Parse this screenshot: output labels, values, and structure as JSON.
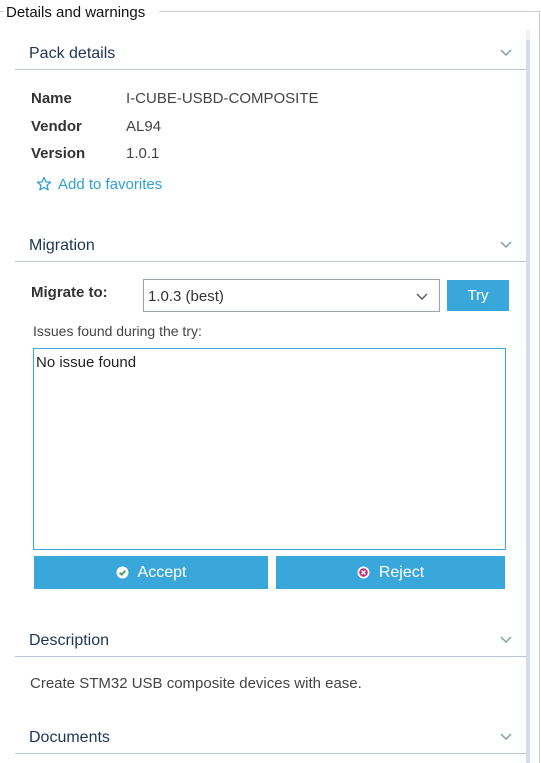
{
  "group": {
    "title": "Details and warnings"
  },
  "pack_details": {
    "header": "Pack details",
    "rows": [
      {
        "key": "Name",
        "value": "I-CUBE-USBD-COMPOSITE"
      },
      {
        "key": "Vendor",
        "value": "AL94"
      },
      {
        "key": "Version",
        "value": "1.0.1"
      }
    ],
    "favorites_label": "Add to favorites"
  },
  "migration": {
    "header": "Migration",
    "migrate_to_label": "Migrate to:",
    "selected_option": "1.0.3 (best)",
    "try_label": "Try",
    "issues_label": "Issues found during the try:",
    "issues_text": "No issue found",
    "accept_label": "Accept",
    "reject_label": "Reject"
  },
  "description": {
    "header": "Description",
    "text": "Create STM32 USB composite devices with ease."
  },
  "documents": {
    "header": "Documents"
  },
  "colors": {
    "accent": "#3aa7da",
    "section_title": "#1f3556",
    "link": "#2f9fd6",
    "accept_icon": "#3aa15a",
    "reject_icon": "#c0307a"
  },
  "icons": {
    "chevron": "chevron-down-icon",
    "favorite": "star-outline-icon",
    "accept": "check-circle-icon",
    "reject": "x-circle-icon"
  }
}
